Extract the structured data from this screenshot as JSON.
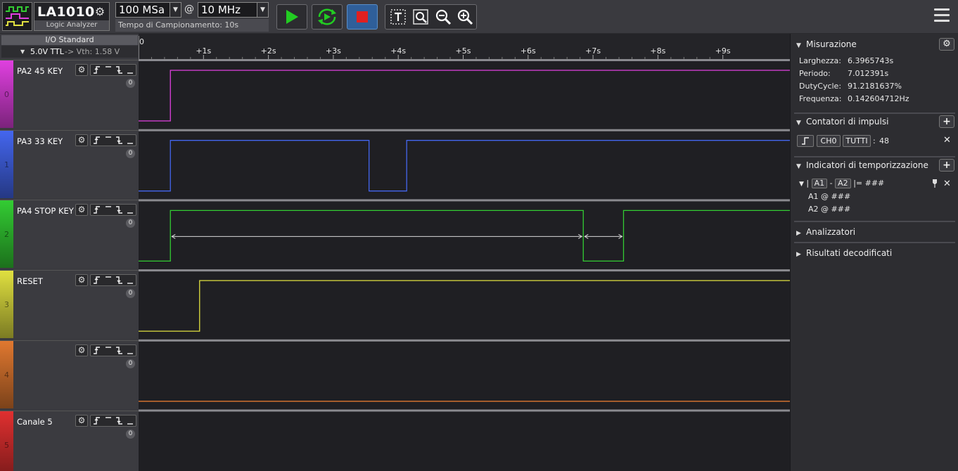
{
  "toolbar": {
    "app_name": "LA1010",
    "app_sub": "Logic Analyzer",
    "sample_rate": "100 MSa",
    "at_symbol": "@",
    "frequency": "10 MHz",
    "sampling_time": "Tempo di Campionamento: 10s"
  },
  "io": {
    "header": "I/O Standard",
    "voltage": "5.0V TTL",
    "vth": "-> Vth:  1.58 V"
  },
  "channels": [
    {
      "index": "0",
      "name": "PA2 45 KEY",
      "count": "0",
      "color": "#e040e0"
    },
    {
      "index": "1",
      "name": "PA3 33 KEY",
      "count": "0",
      "color": "#4466ee"
    },
    {
      "index": "2",
      "name": "PA4  STOP KEY",
      "count": "0",
      "color": "#33cc33"
    },
    {
      "index": "3",
      "name": "RESET",
      "count": "0",
      "color": "#e0e040"
    },
    {
      "index": "4",
      "name": "",
      "count": "0",
      "color": "#e07830"
    },
    {
      "index": "5",
      "name": "Canale 5",
      "count": "0",
      "color": "#e03030"
    }
  ],
  "timeline": {
    "zero_label": "0",
    "ticks": [
      "+1s",
      "+2s",
      "+3s",
      "+4s",
      "+5s",
      "+6s",
      "+7s",
      "+8s",
      "+9s"
    ]
  },
  "measure": {
    "title": "Misurazione",
    "rows": [
      {
        "label": "Larghezza:",
        "value": "6.3965743s"
      },
      {
        "label": "Periodo:",
        "value": "7.012391s"
      },
      {
        "label": "DutyCycle:",
        "value": "91.2181637%"
      },
      {
        "label": "Frequenza:",
        "value": "0.142604712Hz"
      }
    ]
  },
  "pulse_counters": {
    "title": "Contatori di impulsi",
    "channel": "CH0",
    "mode": "TUTTI",
    "separator": ":",
    "count": "48"
  },
  "timing_markers": {
    "title": "Indicatori di temporizzazione",
    "open_bar": "|",
    "a1": "A1",
    "minus": "-",
    "a2": "A2",
    "result": "|= ###",
    "a1_line": "A1 @ ###",
    "a2_line": "A2 @ ###"
  },
  "analyzers": {
    "title": "Analizzatori"
  },
  "decoded": {
    "title": "Risultati decodificati"
  },
  "colors": {
    "accent_blue": "#2f5f9a",
    "play_green": "#22cc22",
    "stop_red": "#e02020"
  }
}
